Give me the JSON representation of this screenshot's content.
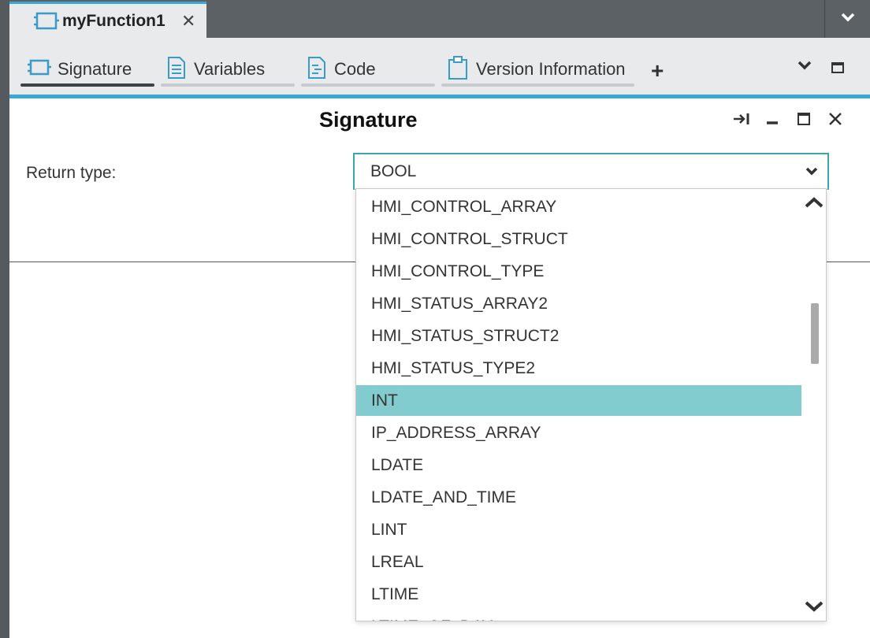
{
  "editor_tab": {
    "title": "myFunction1",
    "close_glyph": "✕"
  },
  "subtabs": [
    {
      "label": "Signature",
      "icon": "function-block-icon",
      "active": true
    },
    {
      "label": "Variables",
      "icon": "document-list-icon",
      "active": false
    },
    {
      "label": "Code",
      "icon": "code-document-icon",
      "active": false
    },
    {
      "label": "Version Information",
      "icon": "clipboard-icon",
      "active": false
    }
  ],
  "add_tab_glyph": "+",
  "panel": {
    "title": "Signature",
    "return_type_label": "Return type:",
    "selected_value": "BOOL"
  },
  "dropdown": {
    "options": [
      "HMI_CONTROL_ARRAY",
      "HMI_CONTROL_STRUCT",
      "HMI_CONTROL_TYPE",
      "HMI_STATUS_ARRAY2",
      "HMI_STATUS_STRUCT2",
      "HMI_STATUS_TYPE2",
      "INT",
      "IP_ADDRESS_ARRAY",
      "LDATE",
      "LDATE_AND_TIME",
      "LINT",
      "LREAL",
      "LTIME",
      "LTIME_OF_DAY"
    ],
    "highlighted": "INT"
  },
  "colors": {
    "accent": "#3aa8d6",
    "highlight": "#82cccf",
    "chrome": "#5c6166"
  }
}
